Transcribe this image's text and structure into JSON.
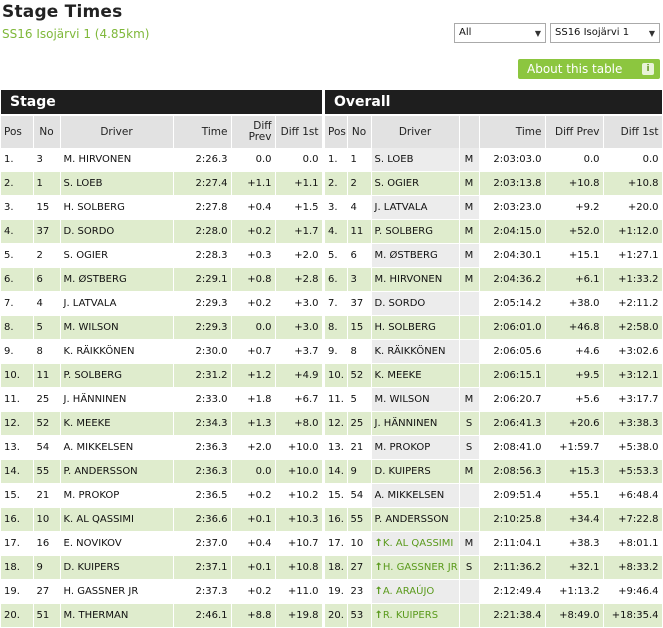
{
  "header": {
    "title": "Stage Times",
    "subtitle": "SS16 Isojärvi 1 (4.85km)",
    "filter_select": "All",
    "stage_select": "SS16 Isojärvi 1",
    "about_button": "About this table",
    "info_icon_glyph": "i"
  },
  "colors": {
    "accent": "#8cc63f",
    "row_alt": "#dfeccd",
    "header_bar": "#1e1e1e",
    "gained": "#5a9a1c"
  },
  "stage": {
    "section_title": "Stage",
    "columns": [
      "Pos",
      "No",
      "Driver",
      "Time",
      "Diff Prev",
      "Diff 1st"
    ],
    "rows": [
      {
        "pos": "1.",
        "no": "3",
        "driver": "M. HIRVONEN",
        "time": "2:26.3",
        "prev": "0.0",
        "first": "0.0"
      },
      {
        "pos": "2.",
        "no": "1",
        "driver": "S. LOEB",
        "time": "2:27.4",
        "prev": "+1.1",
        "first": "+1.1"
      },
      {
        "pos": "3.",
        "no": "15",
        "driver": "H. SOLBERG",
        "time": "2:27.8",
        "prev": "+0.4",
        "first": "+1.5"
      },
      {
        "pos": "4.",
        "no": "37",
        "driver": "D. SORDO",
        "time": "2:28.0",
        "prev": "+0.2",
        "first": "+1.7"
      },
      {
        "pos": "5.",
        "no": "2",
        "driver": "S. OGIER",
        "time": "2:28.3",
        "prev": "+0.3",
        "first": "+2.0"
      },
      {
        "pos": "6.",
        "no": "6",
        "driver": "M. ØSTBERG",
        "time": "2:29.1",
        "prev": "+0.8",
        "first": "+2.8"
      },
      {
        "pos": "7.",
        "no": "4",
        "driver": "J. LATVALA",
        "time": "2:29.3",
        "prev": "+0.2",
        "first": "+3.0"
      },
      {
        "pos": "8.",
        "no": "5",
        "driver": "M. WILSON",
        "time": "2:29.3",
        "prev": "0.0",
        "first": "+3.0"
      },
      {
        "pos": "9.",
        "no": "8",
        "driver": "K. RÄIKKÖNEN",
        "time": "2:30.0",
        "prev": "+0.7",
        "first": "+3.7"
      },
      {
        "pos": "10.",
        "no": "11",
        "driver": "P. SOLBERG",
        "time": "2:31.2",
        "prev": "+1.2",
        "first": "+4.9"
      },
      {
        "pos": "11.",
        "no": "25",
        "driver": "J. HÄNNINEN",
        "time": "2:33.0",
        "prev": "+1.8",
        "first": "+6.7"
      },
      {
        "pos": "12.",
        "no": "52",
        "driver": "K. MEEKE",
        "time": "2:34.3",
        "prev": "+1.3",
        "first": "+8.0"
      },
      {
        "pos": "13.",
        "no": "54",
        "driver": "A. MIKKELSEN",
        "time": "2:36.3",
        "prev": "+2.0",
        "first": "+10.0"
      },
      {
        "pos": "14.",
        "no": "55",
        "driver": "P. ANDERSSON",
        "time": "2:36.3",
        "prev": "0.0",
        "first": "+10.0"
      },
      {
        "pos": "15.",
        "no": "21",
        "driver": "M. PROKOP",
        "time": "2:36.5",
        "prev": "+0.2",
        "first": "+10.2"
      },
      {
        "pos": "16.",
        "no": "10",
        "driver": "K. AL QASSIMI",
        "time": "2:36.6",
        "prev": "+0.1",
        "first": "+10.3"
      },
      {
        "pos": "17.",
        "no": "16",
        "driver": "E. NOVIKOV",
        "time": "2:37.0",
        "prev": "+0.4",
        "first": "+10.7"
      },
      {
        "pos": "18.",
        "no": "9",
        "driver": "D. KUIPERS",
        "time": "2:37.1",
        "prev": "+0.1",
        "first": "+10.8"
      },
      {
        "pos": "19.",
        "no": "27",
        "driver": "H. GASSNER JR",
        "time": "2:37.3",
        "prev": "+0.2",
        "first": "+11.0"
      },
      {
        "pos": "20.",
        "no": "51",
        "driver": "M. THERMAN",
        "time": "2:46.1",
        "prev": "+8.8",
        "first": "+19.8"
      }
    ]
  },
  "overall": {
    "section_title": "Overall",
    "columns": [
      "Pos",
      "No",
      "Driver",
      "",
      "Time",
      "Diff Prev",
      "Diff 1st"
    ],
    "rows": [
      {
        "pos": "1.",
        "no": "1",
        "driver": "S. LOEB",
        "cls": "M",
        "time": "2:03:03.0",
        "prev": "0.0",
        "first": "0.0",
        "up": false
      },
      {
        "pos": "2.",
        "no": "2",
        "driver": "S. OGIER",
        "cls": "M",
        "time": "2:03:13.8",
        "prev": "+10.8",
        "first": "+10.8",
        "up": false
      },
      {
        "pos": "3.",
        "no": "4",
        "driver": "J. LATVALA",
        "cls": "M",
        "time": "2:03:23.0",
        "prev": "+9.2",
        "first": "+20.0",
        "up": false
      },
      {
        "pos": "4.",
        "no": "11",
        "driver": "P. SOLBERG",
        "cls": "M",
        "time": "2:04:15.0",
        "prev": "+52.0",
        "first": "+1:12.0",
        "up": false
      },
      {
        "pos": "5.",
        "no": "6",
        "driver": "M. ØSTBERG",
        "cls": "M",
        "time": "2:04:30.1",
        "prev": "+15.1",
        "first": "+1:27.1",
        "up": false
      },
      {
        "pos": "6.",
        "no": "3",
        "driver": "M. HIRVONEN",
        "cls": "M",
        "time": "2:04:36.2",
        "prev": "+6.1",
        "first": "+1:33.2",
        "up": false
      },
      {
        "pos": "7.",
        "no": "37",
        "driver": "D. SORDO",
        "cls": "",
        "time": "2:05:14.2",
        "prev": "+38.0",
        "first": "+2:11.2",
        "up": false
      },
      {
        "pos": "8.",
        "no": "15",
        "driver": "H. SOLBERG",
        "cls": "",
        "time": "2:06:01.0",
        "prev": "+46.8",
        "first": "+2:58.0",
        "up": false
      },
      {
        "pos": "9.",
        "no": "8",
        "driver": "K. RÄIKKÖNEN",
        "cls": "",
        "time": "2:06:05.6",
        "prev": "+4.6",
        "first": "+3:02.6",
        "up": false
      },
      {
        "pos": "10.",
        "no": "52",
        "driver": "K. MEEKE",
        "cls": "",
        "time": "2:06:15.1",
        "prev": "+9.5",
        "first": "+3:12.1",
        "up": false
      },
      {
        "pos": "11.",
        "no": "5",
        "driver": "M. WILSON",
        "cls": "M",
        "time": "2:06:20.7",
        "prev": "+5.6",
        "first": "+3:17.7",
        "up": false
      },
      {
        "pos": "12.",
        "no": "25",
        "driver": "J. HÄNNINEN",
        "cls": "S",
        "time": "2:06:41.3",
        "prev": "+20.6",
        "first": "+3:38.3",
        "up": false
      },
      {
        "pos": "13.",
        "no": "21",
        "driver": "M. PROKOP",
        "cls": "S",
        "time": "2:08:41.0",
        "prev": "+1:59.7",
        "first": "+5:38.0",
        "up": false
      },
      {
        "pos": "14.",
        "no": "9",
        "driver": "D. KUIPERS",
        "cls": "M",
        "time": "2:08:56.3",
        "prev": "+15.3",
        "first": "+5:53.3",
        "up": false
      },
      {
        "pos": "15.",
        "no": "54",
        "driver": "A. MIKKELSEN",
        "cls": "",
        "time": "2:09:51.4",
        "prev": "+55.1",
        "first": "+6:48.4",
        "up": false
      },
      {
        "pos": "16.",
        "no": "55",
        "driver": "P. ANDERSSON",
        "cls": "",
        "time": "2:10:25.8",
        "prev": "+34.4",
        "first": "+7:22.8",
        "up": false
      },
      {
        "pos": "17.",
        "no": "10",
        "driver": "K. AL QASSIMI",
        "cls": "M",
        "time": "2:11:04.1",
        "prev": "+38.3",
        "first": "+8:01.1",
        "up": true
      },
      {
        "pos": "18.",
        "no": "27",
        "driver": "H. GASSNER JR",
        "cls": "S",
        "time": "2:11:36.2",
        "prev": "+32.1",
        "first": "+8:33.2",
        "up": true
      },
      {
        "pos": "19.",
        "no": "23",
        "driver": "A. ARAÚJO",
        "cls": "",
        "time": "2:12:49.4",
        "prev": "+1:13.2",
        "first": "+9:46.4",
        "up": true
      },
      {
        "pos": "20.",
        "no": "53",
        "driver": "R. KUIPERS",
        "cls": "",
        "time": "2:21:38.4",
        "prev": "+8:49.0",
        "first": "+18:35.4",
        "up": true
      }
    ]
  }
}
